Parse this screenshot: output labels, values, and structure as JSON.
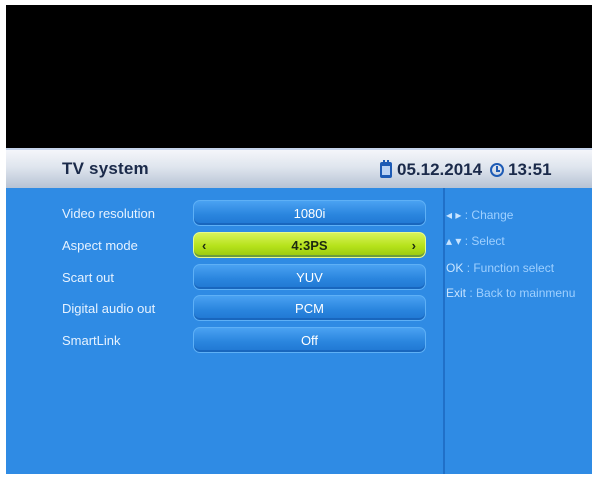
{
  "header": {
    "title": "TV system",
    "date": "05.12.2014",
    "time": "13:51"
  },
  "settings": [
    {
      "label": "Video resolution",
      "value": "1080i"
    },
    {
      "label": "Aspect mode",
      "value": "4:3PS",
      "selected": true,
      "left_arrow": "‹",
      "right_arrow": "›"
    },
    {
      "label": "Scart out",
      "value": "YUV"
    },
    {
      "label": "Digital audio out",
      "value": "PCM"
    },
    {
      "label": "SmartLink",
      "value": "Off"
    }
  ],
  "help": [
    {
      "key": "◂ ▸",
      "text": ": Change"
    },
    {
      "key": "▴ ▾",
      "text": ": Select"
    },
    {
      "key": "OK",
      "text": " : Function select"
    },
    {
      "key": "Exit",
      "text": " : Back to mainmenu"
    }
  ],
  "colors": {
    "panel_blue": "#2f8be4",
    "selected_green": "#b5e21a",
    "header_text": "#1b2a4a"
  }
}
